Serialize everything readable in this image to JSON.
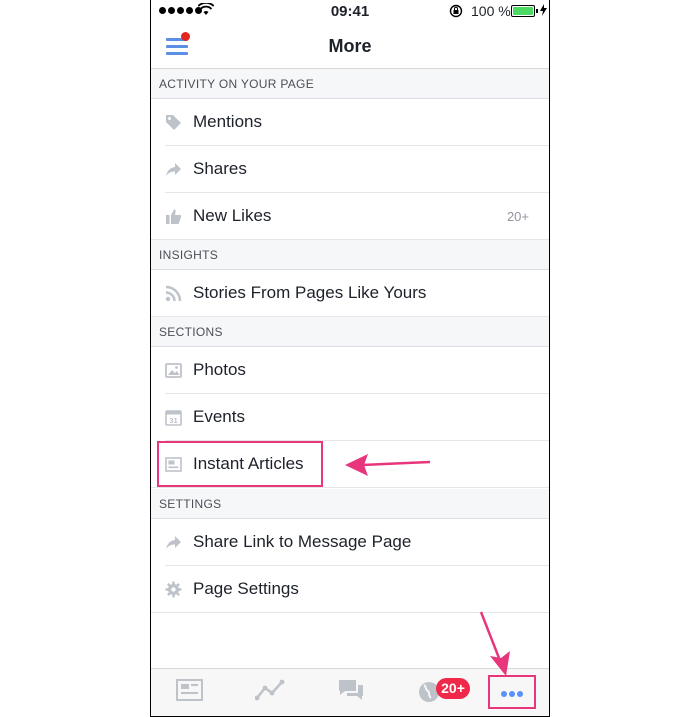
{
  "status_bar": {
    "time": "09:41",
    "battery_percent": "100 %"
  },
  "nav": {
    "title": "More"
  },
  "sections": [
    {
      "header": "ACTIVITY ON YOUR PAGE",
      "items": [
        {
          "label": "Mentions",
          "icon": "tag-icon"
        },
        {
          "label": "Shares",
          "icon": "share-arrow-icon"
        },
        {
          "label": "New Likes",
          "icon": "thumbs-up-icon",
          "count": "20+"
        }
      ]
    },
    {
      "header": "INSIGHTS",
      "items": [
        {
          "label": "Stories From Pages Like Yours",
          "icon": "rss-icon"
        }
      ]
    },
    {
      "header": "SECTIONS",
      "items": [
        {
          "label": "Photos",
          "icon": "photo-icon"
        },
        {
          "label": "Events",
          "icon": "calendar-icon",
          "icon_text": "31"
        },
        {
          "label": "Instant Articles",
          "icon": "article-icon"
        }
      ]
    },
    {
      "header": "SETTINGS",
      "items": [
        {
          "label": "Share Link to Message Page",
          "icon": "share-arrow-icon"
        },
        {
          "label": "Page Settings",
          "icon": "gear-icon"
        }
      ]
    }
  ],
  "tab_bar": {
    "tabs": [
      "feed-icon",
      "insights-chart-icon",
      "messages-icon",
      "notifications-globe-icon",
      "more-icon"
    ],
    "notifications_badge": "20+"
  },
  "colors": {
    "accent": "#5890ff",
    "highlight": "#e8367c",
    "badge": "#f02849"
  }
}
